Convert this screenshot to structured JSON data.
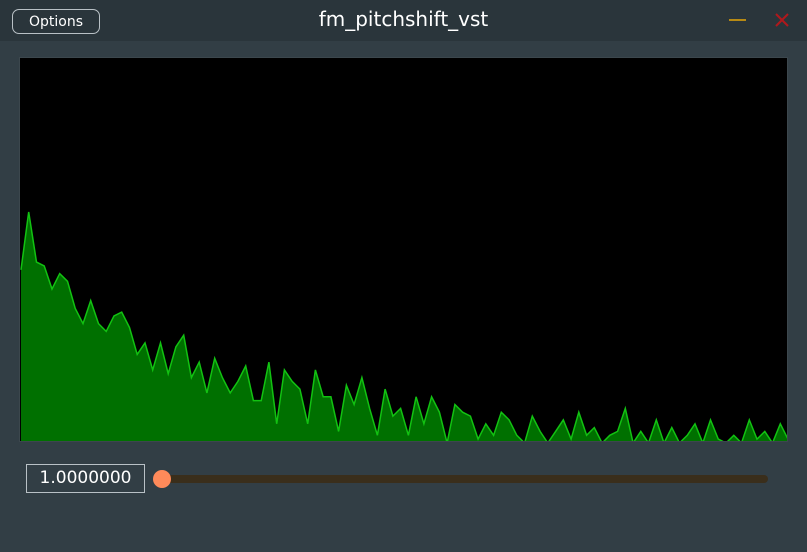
{
  "window": {
    "title": "fm_pitchshift_vst",
    "options_label": "Options",
    "minimize_icon": "minimize-icon",
    "close_icon": "close-icon"
  },
  "colors": {
    "background": "#323e45",
    "titlebar": "#2a353b",
    "spectrum_background": "#000000",
    "spectrum_fill": "#007000",
    "spectrum_line": "#12c212",
    "minimize": "#b78a14",
    "close": "#b0181c",
    "slider_thumb": "#ff8a5a",
    "slider_track": "#3a2e1b"
  },
  "pitch": {
    "value_text": "1.0000000",
    "slider_fraction": 0
  },
  "spectrum": {
    "levels": [
      0.45,
      0.6,
      0.47,
      0.46,
      0.4,
      0.44,
      0.42,
      0.35,
      0.31,
      0.37,
      0.31,
      0.29,
      0.33,
      0.34,
      0.3,
      0.23,
      0.26,
      0.19,
      0.26,
      0.18,
      0.25,
      0.28,
      0.17,
      0.21,
      0.13,
      0.22,
      0.17,
      0.13,
      0.16,
      0.2,
      0.11,
      0.11,
      0.21,
      0.05,
      0.19,
      0.16,
      0.14,
      0.05,
      0.19,
      0.12,
      0.12,
      0.03,
      0.15,
      0.1,
      0.17,
      0.09,
      0.02,
      0.14,
      0.07,
      0.09,
      0.02,
      0.12,
      0.05,
      0.12,
      0.08,
      0.0,
      0.1,
      0.08,
      0.07,
      0.01,
      0.05,
      0.02,
      0.08,
      0.06,
      0.02,
      0.0,
      0.07,
      0.03,
      0.0,
      0.03,
      0.06,
      0.01,
      0.08,
      0.02,
      0.04,
      0.0,
      0.02,
      0.03,
      0.09,
      0.0,
      0.03,
      0.0,
      0.06,
      0.0,
      0.04,
      0.0,
      0.02,
      0.05,
      0.0,
      0.06,
      0.01,
      0.0,
      0.02,
      0.0,
      0.06,
      0.01,
      0.03,
      0.0,
      0.05,
      0.01
    ]
  }
}
